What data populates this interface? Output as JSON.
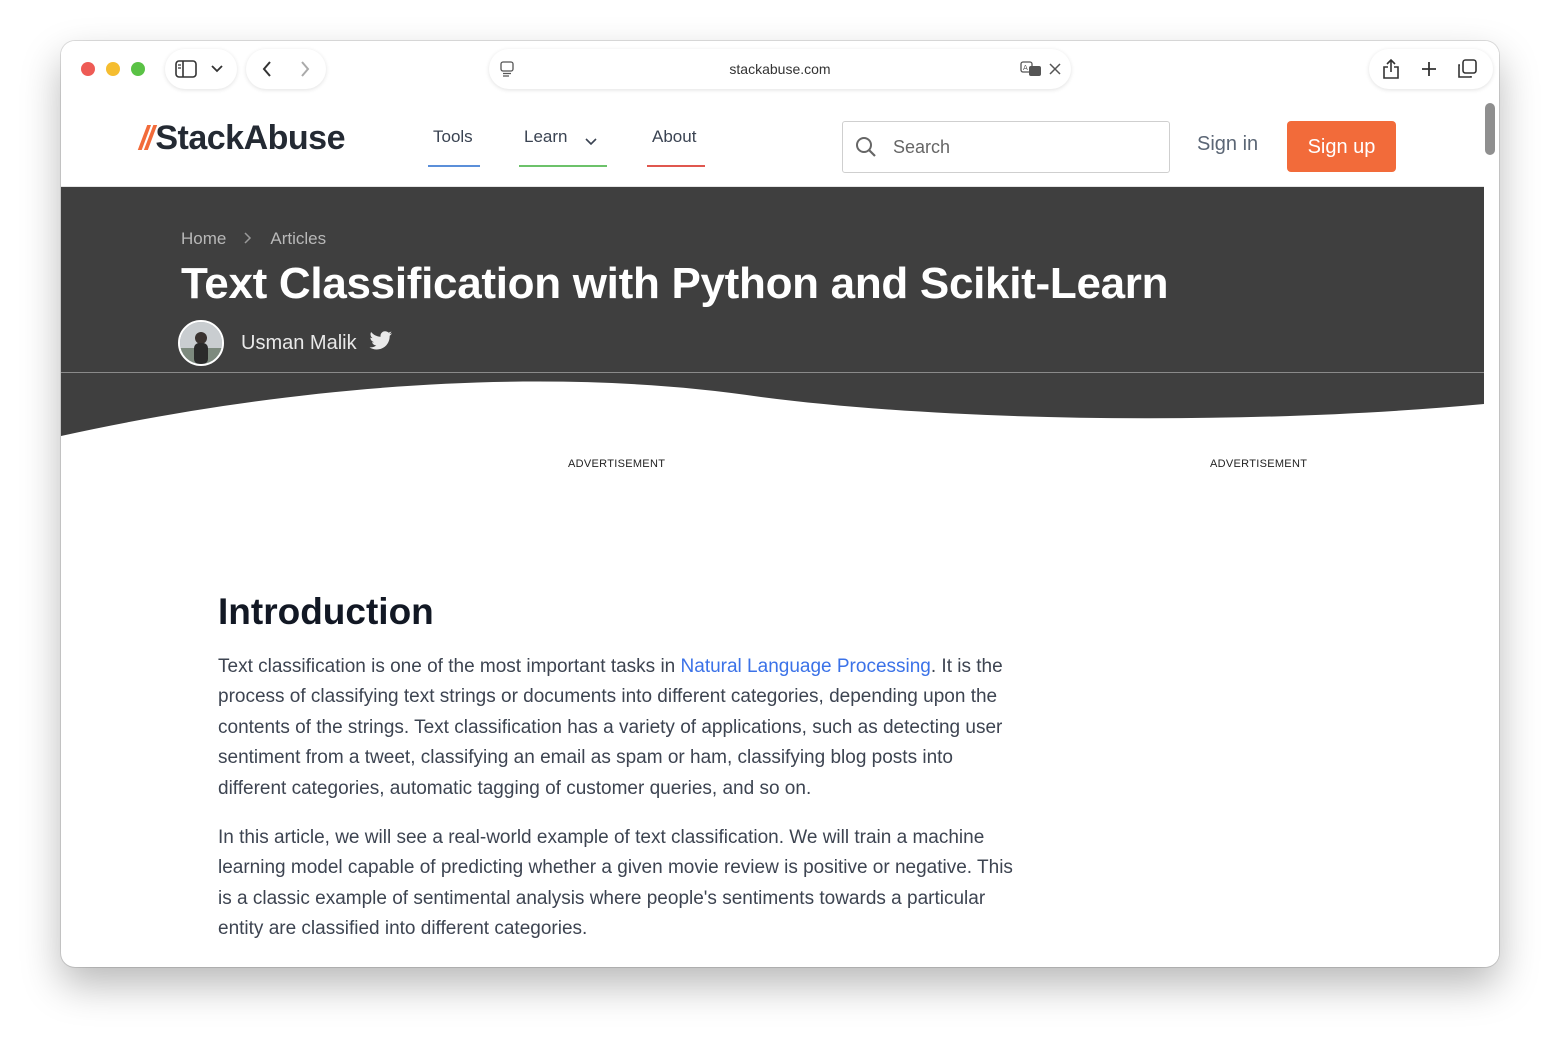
{
  "browser": {
    "url": "stackabuse.com"
  },
  "header": {
    "logo_slashes": "//",
    "logo_text": "StackAbuse",
    "nav": [
      {
        "label": "Tools",
        "underline_color": "#5b8fd9"
      },
      {
        "label": "Learn",
        "underline_color": "#6cc26a"
      },
      {
        "label": "About",
        "underline_color": "#e0574f"
      }
    ],
    "search_placeholder": "Search",
    "signin_label": "Sign in",
    "signup_label": "Sign up"
  },
  "hero": {
    "breadcrumb": [
      "Home",
      "Articles"
    ],
    "title": "Text Classification with Python and Scikit-Learn",
    "author": "Usman Malik"
  },
  "ads": {
    "left_label": "ADVERTISEMENT",
    "right_label": "ADVERTISEMENT"
  },
  "article": {
    "heading": "Introduction",
    "p1_before": "Text classification is one of the most important tasks in ",
    "p1_link": "Natural Language Processing",
    "p1_after": ". It is the process of classifying text strings or documents into different categories, depending upon the contents of the strings. Text classification has a variety of applications, such as detecting user sentiment from a tweet, classifying an email as spam or ham, classifying blog posts into different categories, automatic tagging of customer queries, and so on.",
    "p2": "In this article, we will see a real-world example of text classification. We will train a machine learning model capable of predicting whether a given movie review is positive or negative. This is a classic example of sentimental analysis where people's sentiments towards a particular entity are classified into different categories."
  },
  "colors": {
    "brand_orange": "#f26b3a",
    "hero_bg": "#3f3f3f",
    "link_blue": "#3b72e8"
  }
}
